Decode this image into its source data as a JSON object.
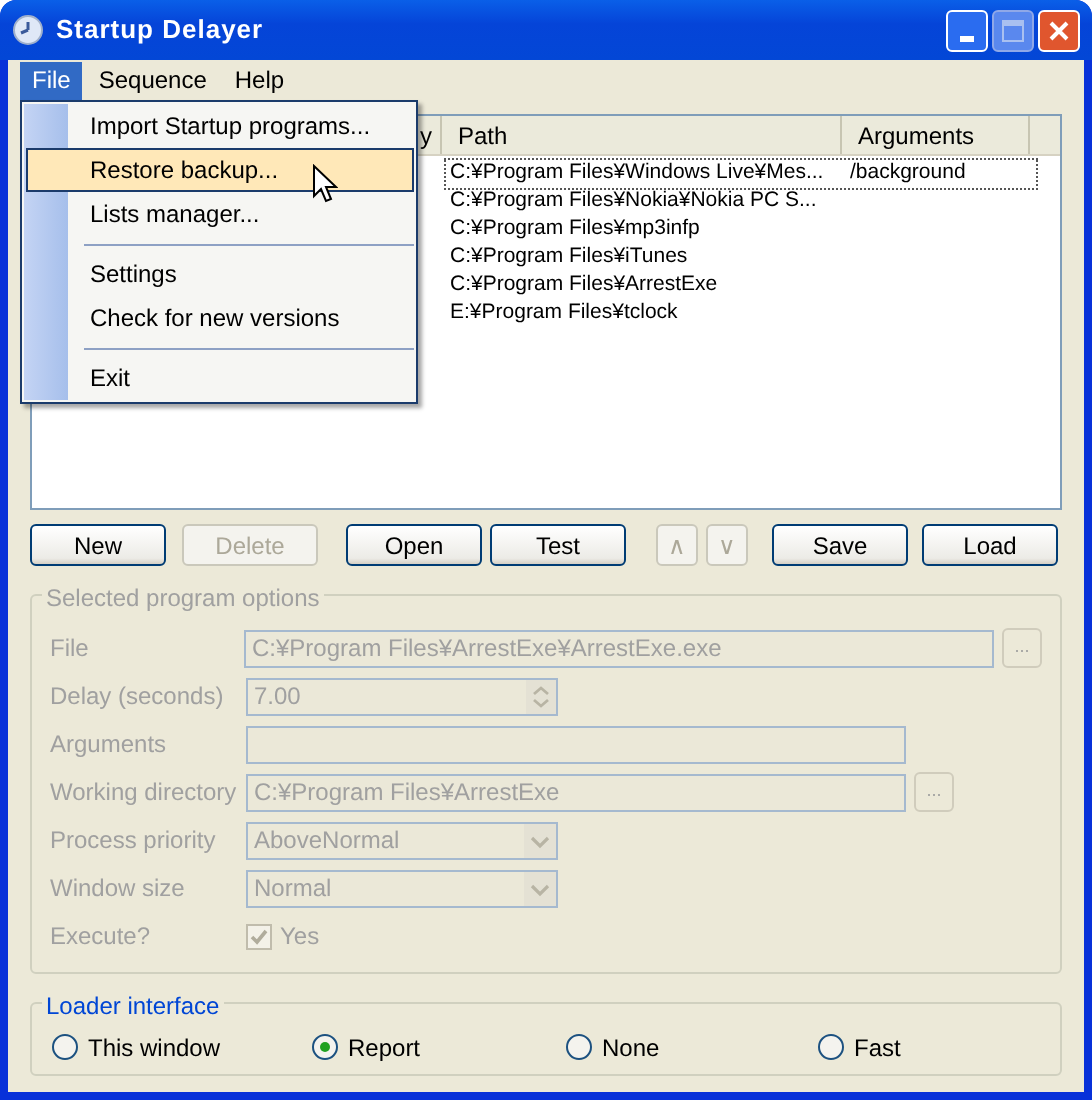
{
  "window": {
    "title": "Startup Delayer"
  },
  "menu_bar": [
    {
      "label": "File",
      "selected": true
    },
    {
      "label": "Sequence",
      "selected": false
    },
    {
      "label": "Help",
      "selected": false
    }
  ],
  "file_menu": [
    {
      "kind": "item",
      "label": "Import Startup programs...",
      "selected": false
    },
    {
      "kind": "item",
      "label": "Restore backup...",
      "selected": true
    },
    {
      "kind": "item",
      "label": "Lists manager...",
      "selected": false
    },
    {
      "kind": "separator"
    },
    {
      "kind": "item",
      "label": "Settings",
      "selected": false
    },
    {
      "kind": "item",
      "label": "Check for new versions",
      "selected": false
    },
    {
      "kind": "separator"
    },
    {
      "kind": "item",
      "label": "Exit",
      "selected": false
    }
  ],
  "table": {
    "columns": [
      "y",
      "Path",
      "Arguments"
    ],
    "rows": [
      {
        "path": "C:¥Program Files¥Windows Live¥Mes...",
        "arguments": "/background",
        "selected": true
      },
      {
        "path": "C:¥Program Files¥Nokia¥Nokia PC S...",
        "selected": false
      },
      {
        "path": "C:¥Program Files¥mp3infp",
        "selected": false
      },
      {
        "path": "C:¥Program Files¥iTunes",
        "selected": false
      },
      {
        "path": "C:¥Program Files¥ArrestExe",
        "selected": false
      },
      {
        "path": "E:¥Program Files¥tclock",
        "selected": false
      }
    ]
  },
  "buttons": [
    {
      "label": "New",
      "disabled": false,
      "kind": "wide"
    },
    {
      "label": "Delete",
      "disabled": true,
      "kind": "wide"
    },
    {
      "label": "Open",
      "disabled": false,
      "kind": "wide"
    },
    {
      "label": "Test",
      "disabled": false,
      "kind": "wide"
    },
    {
      "label": "∧",
      "disabled": true,
      "kind": "small"
    },
    {
      "label": "∨",
      "disabled": true,
      "kind": "small"
    },
    {
      "label": "Save",
      "disabled": false,
      "kind": "wide"
    },
    {
      "label": "Load",
      "disabled": false,
      "kind": "wide"
    }
  ],
  "options": {
    "title": "Selected program options",
    "disabled": true,
    "fields": [
      {
        "kind": "browse",
        "label": "File",
        "value": "C:¥Program Files¥ArrestExe¥ArrestExe.exe",
        "browse": "..."
      },
      {
        "kind": "spin",
        "label": "Delay (seconds)",
        "value": "7.00"
      },
      {
        "kind": "text",
        "label": "Arguments"
      },
      {
        "kind": "browse-short",
        "label": "Working directory",
        "value": "C:¥Program Files¥ArrestExe",
        "browse": "..."
      },
      {
        "kind": "combo",
        "label": "Process priority",
        "value": "AboveNormal"
      },
      {
        "kind": "combo",
        "label": "Window size",
        "value": "Normal"
      },
      {
        "kind": "check",
        "label": "Execute?",
        "value": "Yes",
        "checked": true
      }
    ]
  },
  "loader_interface": {
    "title": "Loader interface",
    "options": [
      {
        "label": "This window",
        "selected": false
      },
      {
        "label": "Report",
        "selected": true
      },
      {
        "label": "None",
        "selected": false
      },
      {
        "label": "Fast",
        "selected": false
      }
    ]
  }
}
